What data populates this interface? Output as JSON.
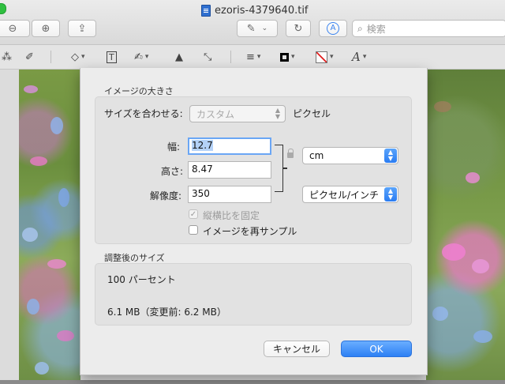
{
  "window": {
    "title": "ezoris-4379640.tif"
  },
  "toolbar": {
    "search_placeholder": "検索"
  },
  "dialog": {
    "size_section_title": "イメージの大きさ",
    "fit_label": "サイズを合わせる:",
    "fit_value": "カスタム",
    "fit_unit": "ピクセル",
    "width_label": "幅:",
    "width_value": "12.7",
    "height_label": "高さ:",
    "height_value": "8.47",
    "resolution_label": "解像度:",
    "resolution_value": "350",
    "unit_value": "cm",
    "resolution_unit_value": "ピクセル/インチ",
    "proportional_label": "縦横比を固定",
    "proportional_checked": true,
    "resample_label": "イメージを再サンプル",
    "resample_checked": false,
    "result_section_title": "調整後のサイズ",
    "result_percent": "100 パーセント",
    "result_size": "6.1 MB（変更前: 6.2 MB）",
    "cancel_label": "キャンセル",
    "ok_label": "OK"
  },
  "colors": {
    "accent": "#2a7cf2",
    "ok_button": "#3a86f5"
  }
}
